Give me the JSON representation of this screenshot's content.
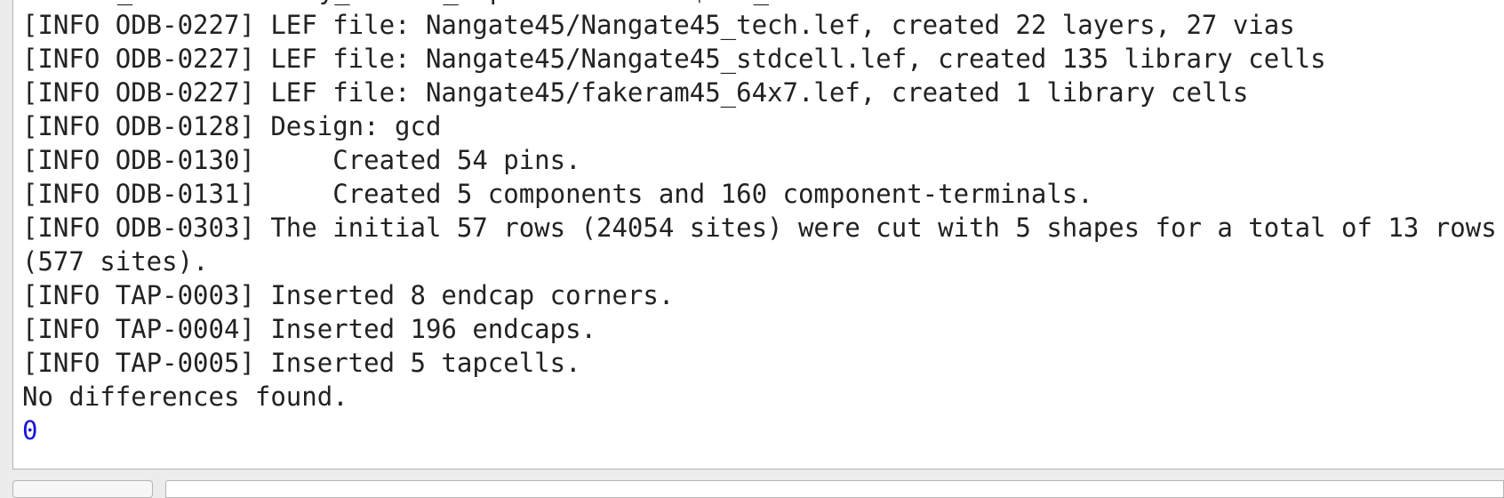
{
  "console": {
    "partial_first_line": "% diff_file boundary_macros_separation.def $def_file",
    "lines": [
      "[INFO ODB-0227] LEF file: Nangate45/Nangate45_tech.lef, created 22 layers, 27 vias",
      "[INFO ODB-0227] LEF file: Nangate45/Nangate45_stdcell.lef, created 135 library cells",
      "[INFO ODB-0227] LEF file: Nangate45/fakeram45_64x7.lef, created 1 library cells",
      "[INFO ODB-0128] Design: gcd",
      "[INFO ODB-0130]     Created 54 pins.",
      "[INFO ODB-0131]     Created 5 components and 160 component-terminals.",
      "[INFO ODB-0303] The initial 57 rows (24054 sites) were cut with 5 shapes for a total of 13 rows (577 sites).",
      "[INFO TAP-0003] Inserted 8 endcap corners.",
      "[INFO TAP-0004] Inserted 196 endcaps.",
      "[INFO TAP-0005] Inserted 5 tapcells.",
      "No differences found."
    ],
    "result": "0"
  },
  "colors": {
    "text": "#222222",
    "result": "#1414dc",
    "panel_bg": "#ffffff",
    "window_bg": "#ececec"
  }
}
